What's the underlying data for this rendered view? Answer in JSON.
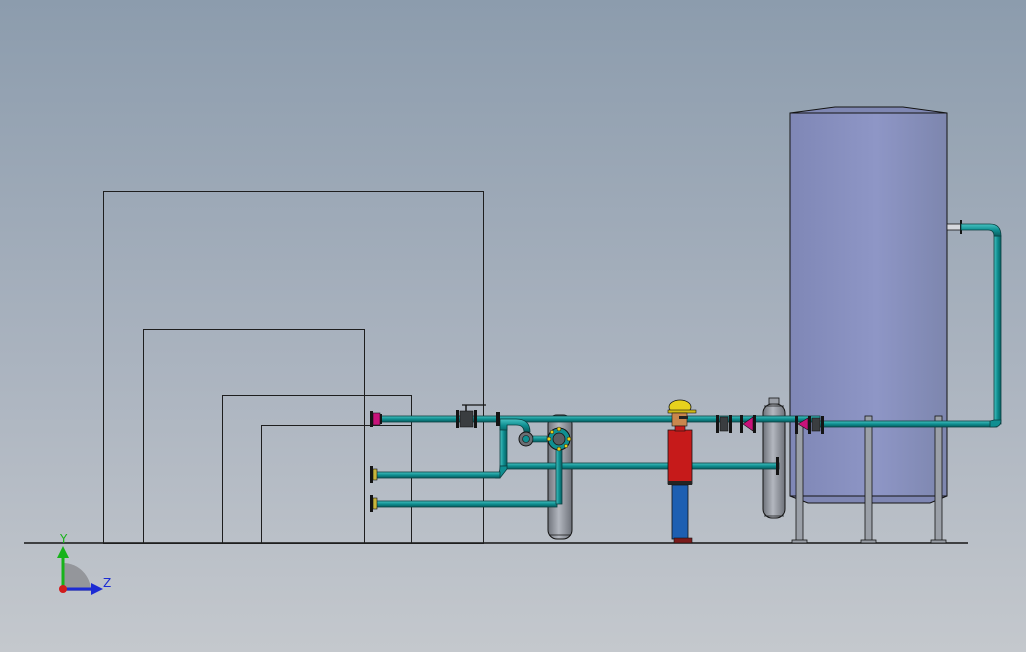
{
  "view": {
    "background_top": "#8c9cad",
    "background_bottom": "#c4c8cd"
  },
  "colors": {
    "pipe": "#0f8f91",
    "pipe_highlight": "#49c3c2",
    "tank": "#8790bd",
    "vessel": "#9a9ea6",
    "valve_accent": "#c8127a",
    "outline": "#141414",
    "worker_shirt": "#c61a1a",
    "worker_pants": "#1d5fb2",
    "worker_helmet": "#e8d21d",
    "axis_y": "#17b31a",
    "axis_z": "#1c2bd4",
    "axis_origin": "#d11b1b"
  },
  "triad": {
    "y_label": "Y",
    "z_label": "Z"
  },
  "components": {
    "boxes": [
      "box-outer",
      "box-second",
      "box-third",
      "box-inner"
    ],
    "equipment": [
      "storage-tank",
      "vertical-vessel",
      "small-separator",
      "worker-figure",
      "pipe-rack-legs"
    ],
    "piping": [
      "upper-header",
      "middle-line",
      "lower-line",
      "tank-return-riser"
    ],
    "valves": [
      "flange-valve-left",
      "gate-valve-upper",
      "check-valve",
      "y-strainer",
      "tank-inlet-valves"
    ]
  }
}
